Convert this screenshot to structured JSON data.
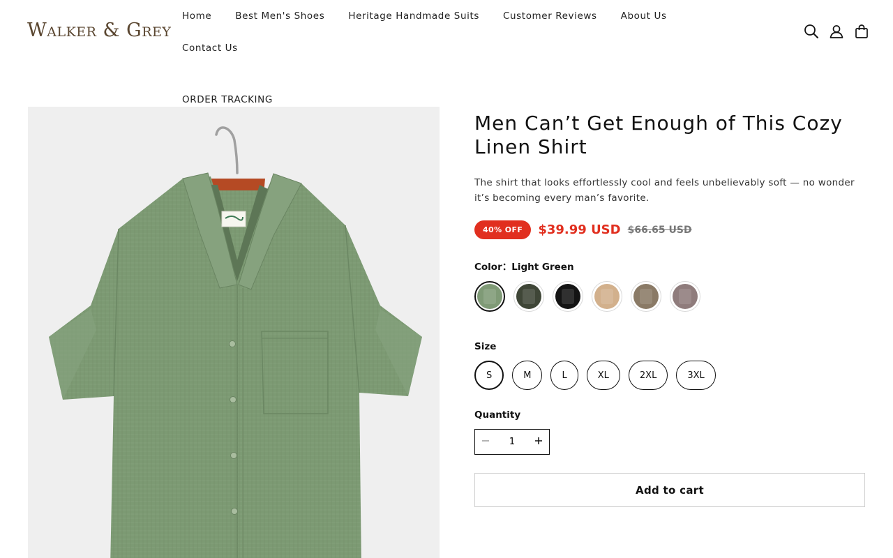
{
  "brand": {
    "logo_text": "Walker & Grey"
  },
  "nav": {
    "items": [
      "Home",
      "Best Men's Shoes",
      "Heritage Handmade Suits",
      "Customer Reviews",
      "About Us",
      "Contact Us"
    ],
    "second_row": "ORDER TRACKING"
  },
  "header_icons": [
    "search-icon",
    "account-icon",
    "cart-icon"
  ],
  "product": {
    "title": "Men Can’t Get Enough of This Cozy Linen Shirt",
    "description": "The shirt that looks effortlessly cool and feels unbelievably soft — no wonder it’s becoming every man’s favorite.",
    "badge": "40% OFF",
    "price": "$39.99 USD",
    "compare_price": "$66.65 USD",
    "color_label": "Color",
    "color_separator": "：",
    "selected_color": "Light Green",
    "swatch_colors": [
      "#7f9a76",
      "#3f4637",
      "#141414",
      "#d2b08c",
      "#8a7a66",
      "#8f7c7c"
    ],
    "size_label": "Size",
    "sizes": [
      "S",
      "M",
      "L",
      "XL",
      "2XL",
      "3XL"
    ],
    "selected_size": "S",
    "quantity_label": "Quantity",
    "quantity": "1",
    "add_to_cart": "Add to cart"
  },
  "colors": {
    "sale_red": "#e12f1f",
    "shirt_green": "#7c9a73",
    "image_bg": "#efefef",
    "hanger_wood": "#b54a24"
  }
}
